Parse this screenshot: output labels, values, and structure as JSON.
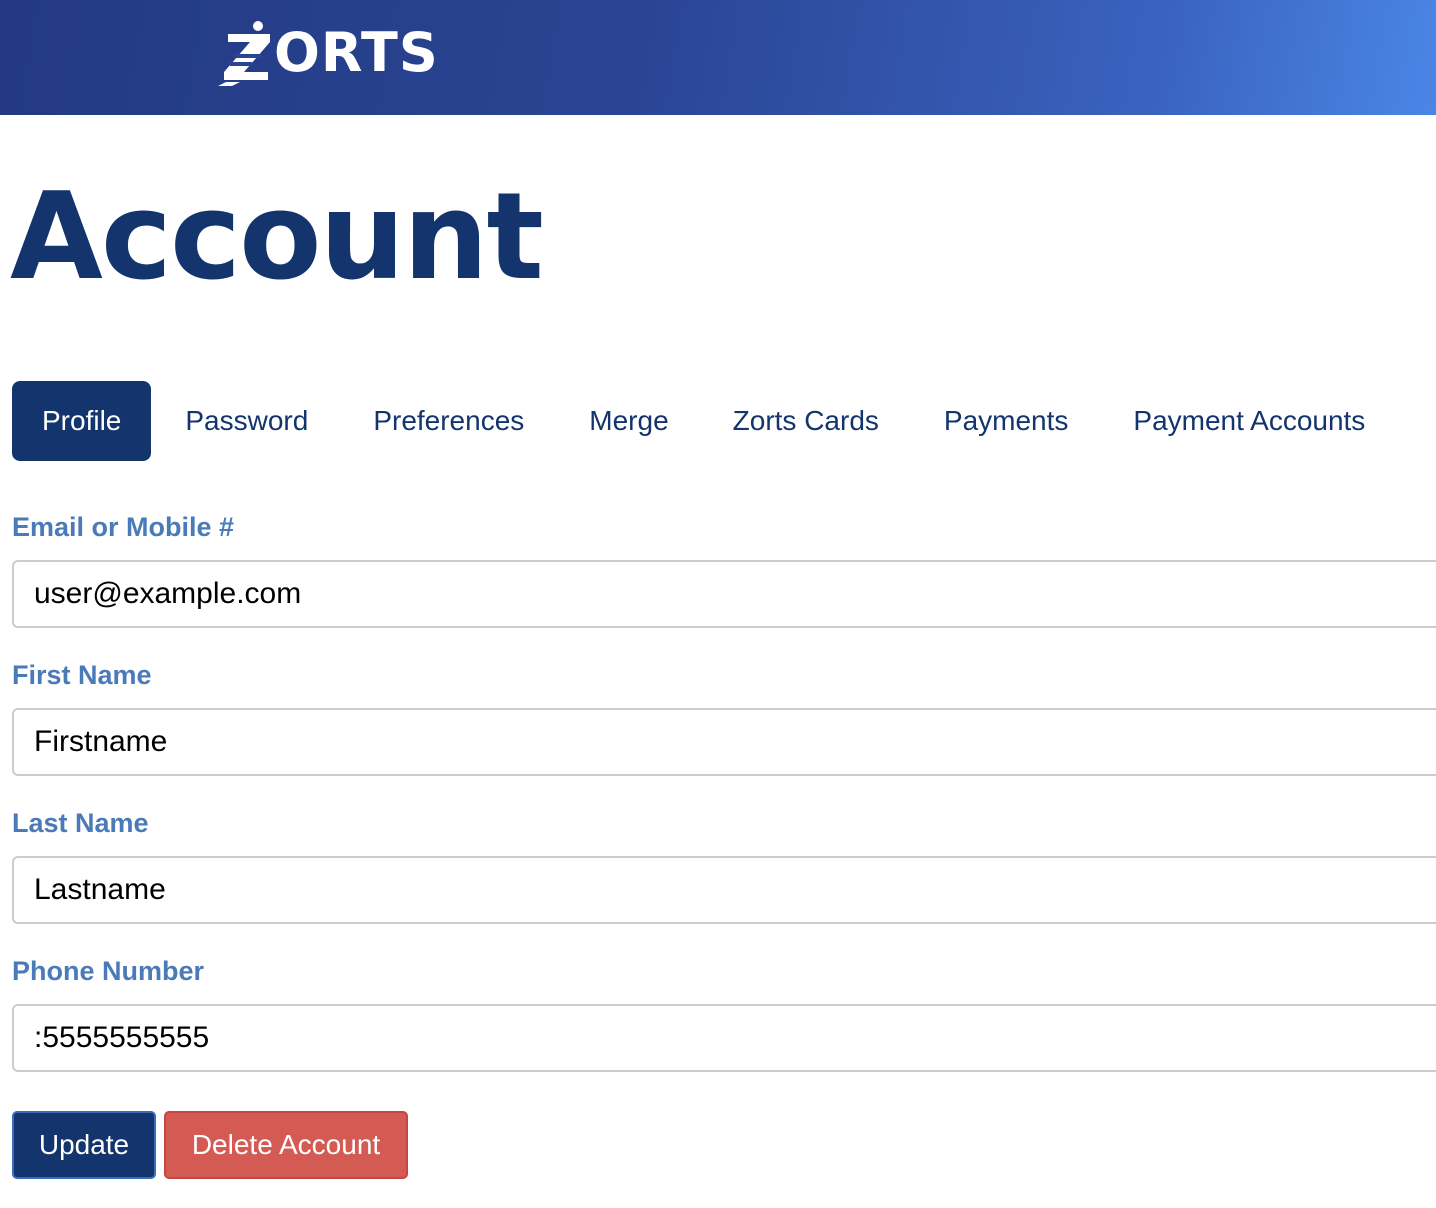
{
  "header": {
    "logo_text": "ORTS",
    "logo_brand": "ZORTS"
  },
  "page": {
    "title": "Account"
  },
  "tabs": [
    {
      "label": "Profile",
      "active": true
    },
    {
      "label": "Password",
      "active": false
    },
    {
      "label": "Preferences",
      "active": false
    },
    {
      "label": "Merge",
      "active": false
    },
    {
      "label": "Zorts Cards",
      "active": false
    },
    {
      "label": "Payments",
      "active": false
    },
    {
      "label": "Payment Accounts",
      "active": false
    }
  ],
  "form": {
    "email": {
      "label": "Email or Mobile #",
      "value": "user@example.com"
    },
    "first_name": {
      "label": "First Name",
      "value": "Firstname"
    },
    "last_name": {
      "label": "Last Name",
      "value": "Lastname"
    },
    "phone": {
      "label": "Phone Number",
      "value": ":5555555555"
    }
  },
  "actions": {
    "update_label": "Update",
    "delete_label": "Delete Account"
  },
  "colors": {
    "primary": "#13346c",
    "label": "#4a7ab8",
    "danger": "#d35b54",
    "header_start": "#233a82",
    "header_end": "#4a86e6"
  }
}
